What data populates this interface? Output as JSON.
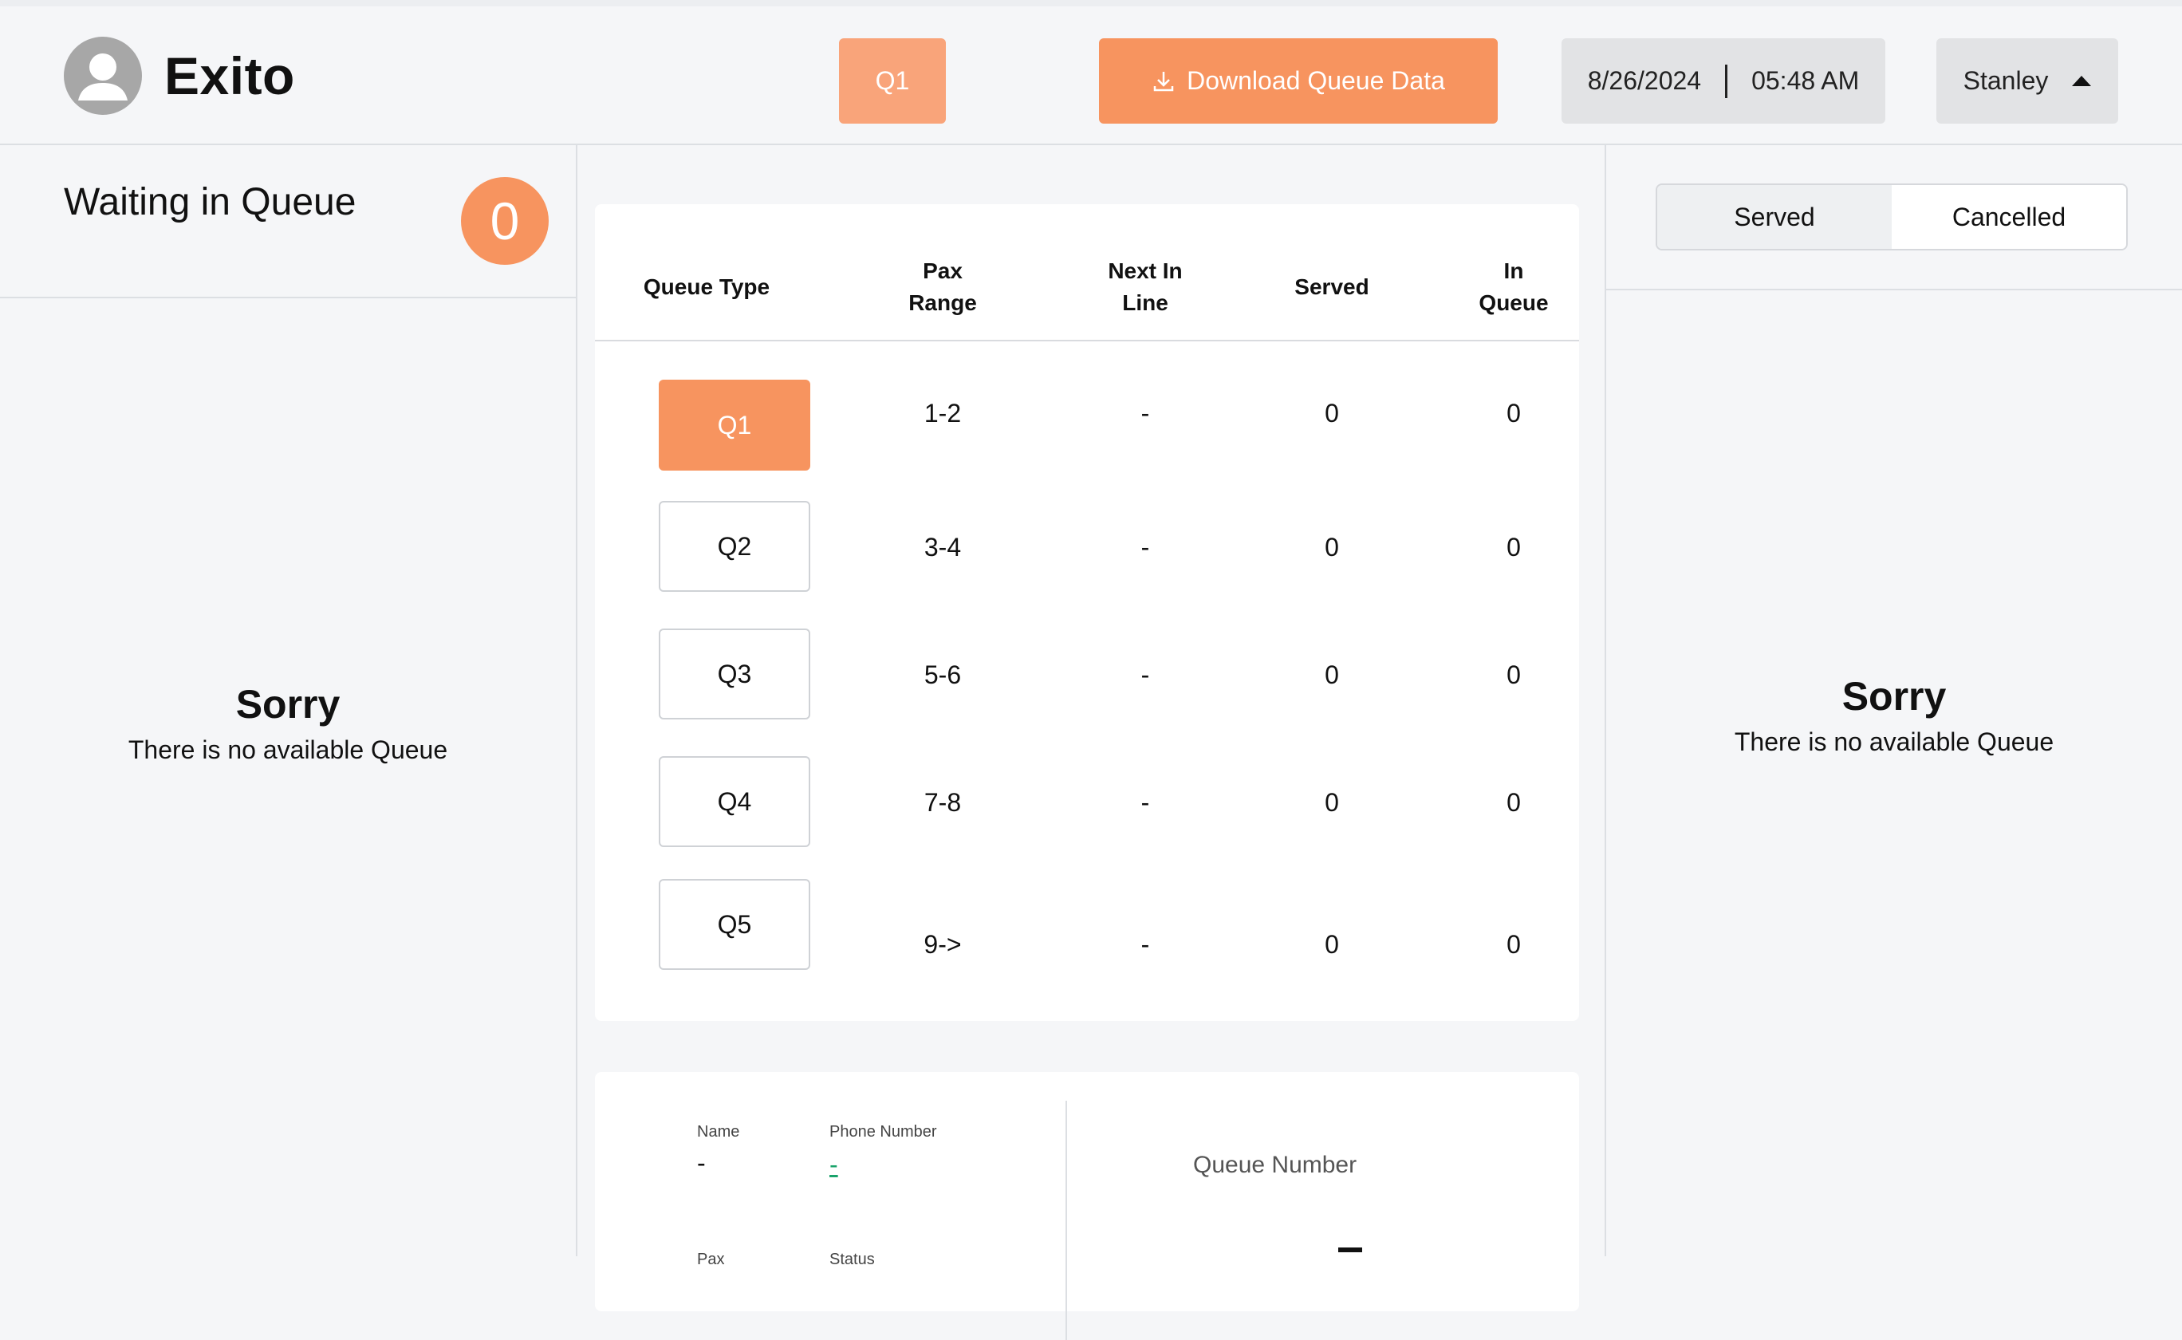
{
  "header": {
    "brand_name": "Exito",
    "queue_chip": "Q1",
    "download_label": "Download Queue Data",
    "date": "8/26/2024",
    "time": "05:48 AM",
    "user_name": "Stanley"
  },
  "left_panel": {
    "title": "Waiting in Queue",
    "count": "0",
    "empty_title": "Sorry",
    "empty_subtitle": "There is no available Queue"
  },
  "queue_table": {
    "headers": {
      "queue_type": "Queue Type",
      "pax_range_1": "Pax",
      "pax_range_2": "Range",
      "next_in_line_1": "Next In",
      "next_in_line_2": "Line",
      "served": "Served",
      "in_queue_1": "In",
      "in_queue_2": "Queue"
    },
    "rows": [
      {
        "queue": "Q1",
        "pax": "1-2",
        "next": "-",
        "served": "0",
        "in_queue": "0"
      },
      {
        "queue": "Q2",
        "pax": "3-4",
        "next": "-",
        "served": "0",
        "in_queue": "0"
      },
      {
        "queue": "Q3",
        "pax": "5-6",
        "next": "-",
        "served": "0",
        "in_queue": "0"
      },
      {
        "queue": "Q4",
        "pax": "7-8",
        "next": "-",
        "served": "0",
        "in_queue": "0"
      },
      {
        "queue": "Q5",
        "pax": "9->",
        "next": "-",
        "served": "0",
        "in_queue": "0"
      }
    ]
  },
  "details": {
    "name_label": "Name",
    "name_value": "-",
    "phone_label": "Phone Number",
    "phone_value": "-",
    "pax_label": "Pax",
    "status_label": "Status",
    "queue_number_label": "Queue Number"
  },
  "right_panel": {
    "tab_served": "Served",
    "tab_cancelled": "Cancelled",
    "empty_title": "Sorry",
    "empty_subtitle": "There is no available Queue"
  },
  "colors": {
    "accent": "#f7945f",
    "accent_light": "#f9a47a",
    "link_green": "#1aa36b"
  }
}
